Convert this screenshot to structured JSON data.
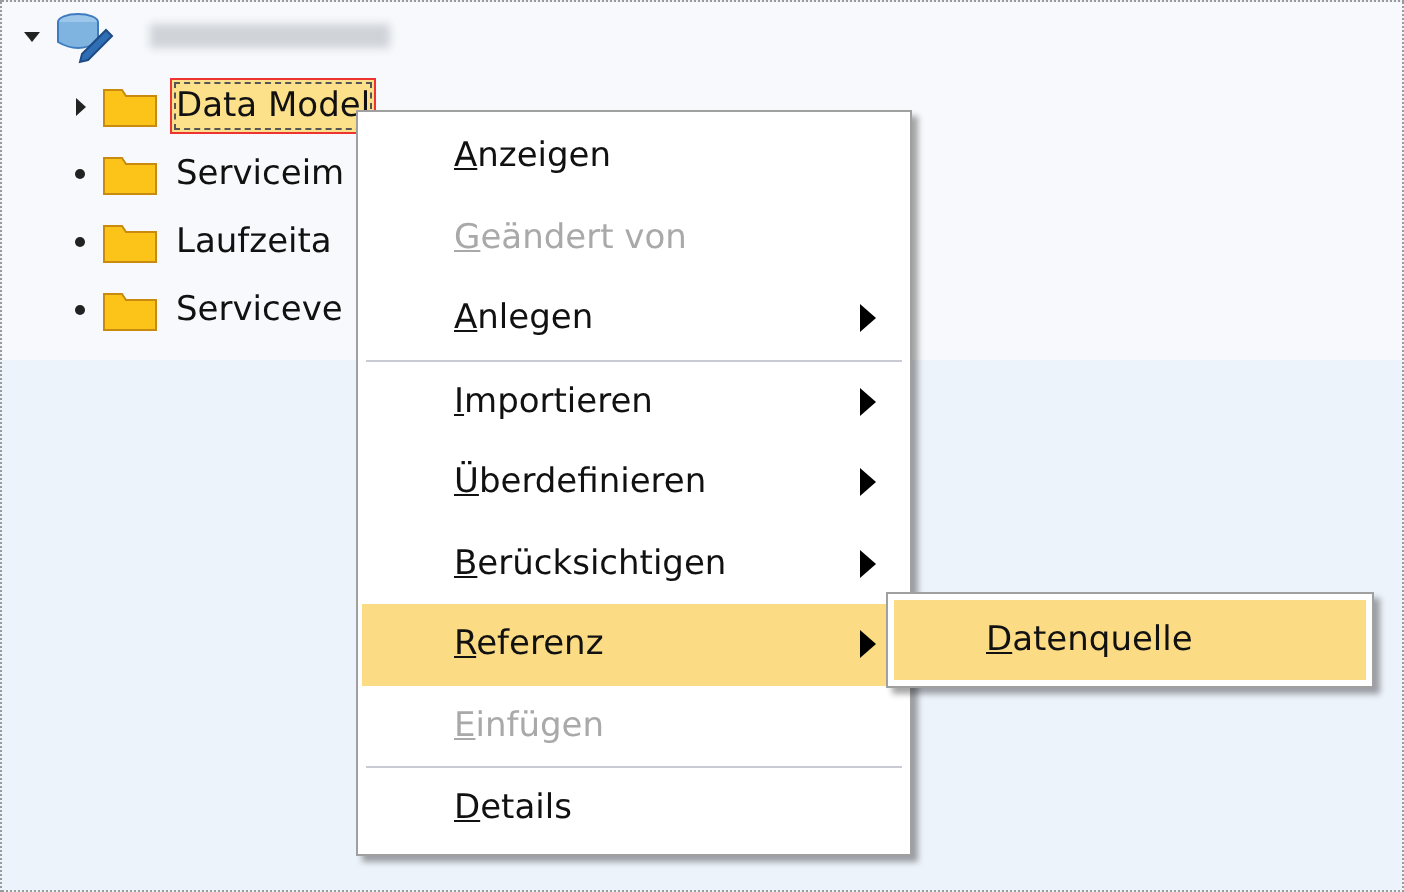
{
  "tree": {
    "root": {
      "expanded": true,
      "children": [
        {
          "label": "Data Model",
          "kind": "expandable",
          "selected": true
        },
        {
          "label": "Serviceim",
          "kind": "leaf",
          "selected": false
        },
        {
          "label": "Laufzeita",
          "kind": "leaf",
          "selected": false
        },
        {
          "label": "Serviceve",
          "kind": "leaf",
          "selected": false
        }
      ]
    }
  },
  "context_menu": {
    "items": [
      {
        "kind": "item",
        "label": "Anzeigen",
        "disabled": false,
        "submenu": false,
        "selected": false
      },
      {
        "kind": "item",
        "label": "Geändert von",
        "disabled": true,
        "submenu": false,
        "selected": false
      },
      {
        "kind": "item",
        "label": "Anlegen",
        "disabled": false,
        "submenu": true,
        "selected": false
      },
      {
        "kind": "separator"
      },
      {
        "kind": "item",
        "label": "Importieren",
        "disabled": false,
        "submenu": true,
        "selected": false
      },
      {
        "kind": "item",
        "label": "Überdefinieren",
        "disabled": false,
        "submenu": true,
        "selected": false
      },
      {
        "kind": "item",
        "label": "Berücksichtigen",
        "disabled": false,
        "submenu": true,
        "selected": false
      },
      {
        "kind": "item",
        "label": "Referenz",
        "disabled": false,
        "submenu": true,
        "selected": true
      },
      {
        "kind": "item",
        "label": "Einfügen",
        "disabled": true,
        "submenu": false,
        "selected": false
      },
      {
        "kind": "separator"
      },
      {
        "kind": "item",
        "label": "Details",
        "disabled": false,
        "submenu": false,
        "selected": false
      }
    ]
  },
  "submenu": {
    "items": [
      {
        "label": "Datenquelle",
        "selected": true
      }
    ]
  }
}
